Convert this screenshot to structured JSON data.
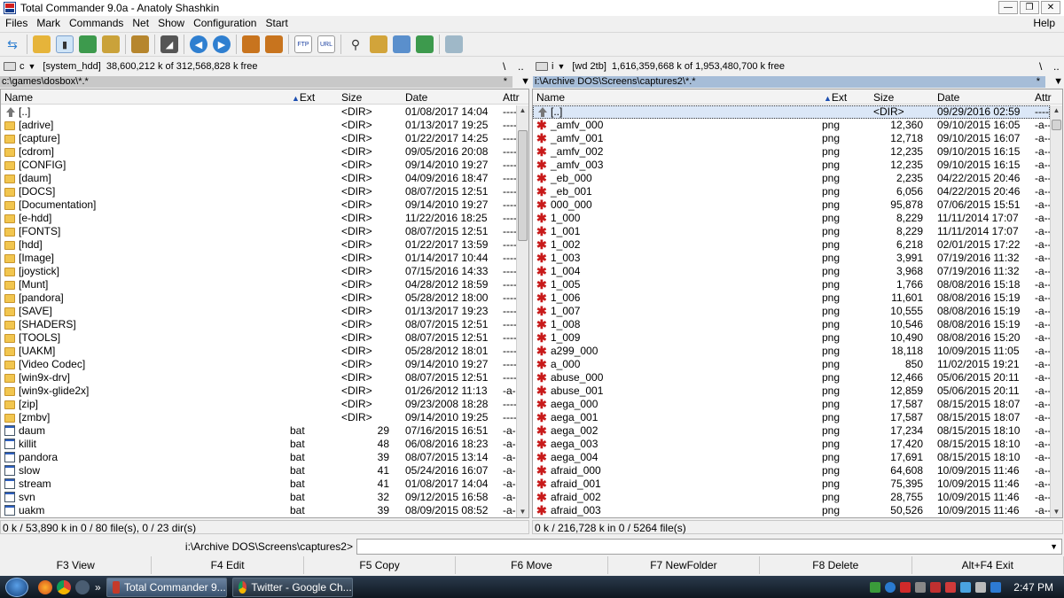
{
  "window": {
    "title": "Total Commander 9.0a - Anatoly Shashkin"
  },
  "menu": {
    "items": [
      "Files",
      "Mark",
      "Commands",
      "Net",
      "Show",
      "Configuration",
      "Start"
    ],
    "help": "Help"
  },
  "toolbar": {
    "icons": [
      "refresh-icon",
      "brief-view-icon",
      "tree-view-icon",
      "thumbnails-icon",
      "sync-icon",
      "invert-icon",
      "compare-icon",
      "back-icon",
      "forward-icon",
      "pack-icon",
      "unpack-icon",
      "ftp-icon",
      "url-icon",
      "search-icon",
      "multi-rename-icon",
      "sync-dirs-icon",
      "copy-names-icon",
      "notepad-icon"
    ]
  },
  "left": {
    "drive": "c",
    "drive_label": "[system_hdd]",
    "free": "38,600,212 k of 312,568,828 k free",
    "backslash": "\\",
    "dotdot": "..",
    "path": "c:\\games\\dosbox\\*.*",
    "star": "*",
    "headers": {
      "name": "Name",
      "ext": "Ext",
      "size": "Size",
      "date": "Date",
      "attr": "Attr"
    },
    "rows": [
      {
        "t": "up",
        "name": "[..]",
        "ext": "",
        "size": "<DIR>",
        "date": "01/08/2017 14:04",
        "attr": "----"
      },
      {
        "t": "dir",
        "name": "[adrive]",
        "ext": "",
        "size": "<DIR>",
        "date": "01/13/2017 19:25",
        "attr": "----"
      },
      {
        "t": "dir",
        "name": "[capture]",
        "ext": "",
        "size": "<DIR>",
        "date": "01/22/2017 14:25",
        "attr": "----"
      },
      {
        "t": "dir",
        "name": "[cdrom]",
        "ext": "",
        "size": "<DIR>",
        "date": "09/05/2016 20:08",
        "attr": "----"
      },
      {
        "t": "dir",
        "name": "[CONFIG]",
        "ext": "",
        "size": "<DIR>",
        "date": "09/14/2010 19:27",
        "attr": "----"
      },
      {
        "t": "dir",
        "name": "[daum]",
        "ext": "",
        "size": "<DIR>",
        "date": "04/09/2016 18:47",
        "attr": "----"
      },
      {
        "t": "dir",
        "name": "[DOCS]",
        "ext": "",
        "size": "<DIR>",
        "date": "08/07/2015 12:51",
        "attr": "----"
      },
      {
        "t": "dir",
        "name": "[Documentation]",
        "ext": "",
        "size": "<DIR>",
        "date": "09/14/2010 19:27",
        "attr": "----"
      },
      {
        "t": "dir",
        "name": "[e-hdd]",
        "ext": "",
        "size": "<DIR>",
        "date": "11/22/2016 18:25",
        "attr": "----"
      },
      {
        "t": "dir",
        "name": "[FONTS]",
        "ext": "",
        "size": "<DIR>",
        "date": "08/07/2015 12:51",
        "attr": "----"
      },
      {
        "t": "dir",
        "name": "[hdd]",
        "ext": "",
        "size": "<DIR>",
        "date": "01/22/2017 13:59",
        "attr": "----"
      },
      {
        "t": "dir",
        "name": "[Image]",
        "ext": "",
        "size": "<DIR>",
        "date": "01/14/2017 10:44",
        "attr": "----"
      },
      {
        "t": "dir",
        "name": "[joystick]",
        "ext": "",
        "size": "<DIR>",
        "date": "07/15/2016 14:33",
        "attr": "----"
      },
      {
        "t": "dir",
        "name": "[Munt]",
        "ext": "",
        "size": "<DIR>",
        "date": "04/28/2012 18:59",
        "attr": "----"
      },
      {
        "t": "dir",
        "name": "[pandora]",
        "ext": "",
        "size": "<DIR>",
        "date": "05/28/2012 18:00",
        "attr": "----"
      },
      {
        "t": "dir",
        "name": "[SAVE]",
        "ext": "",
        "size": "<DIR>",
        "date": "01/13/2017 19:23",
        "attr": "----"
      },
      {
        "t": "dir",
        "name": "[SHADERS]",
        "ext": "",
        "size": "<DIR>",
        "date": "08/07/2015 12:51",
        "attr": "----"
      },
      {
        "t": "dir",
        "name": "[TOOLS]",
        "ext": "",
        "size": "<DIR>",
        "date": "08/07/2015 12:51",
        "attr": "----"
      },
      {
        "t": "dir",
        "name": "[UAKM]",
        "ext": "",
        "size": "<DIR>",
        "date": "05/28/2012 18:01",
        "attr": "----"
      },
      {
        "t": "dir",
        "name": "[Video Codec]",
        "ext": "",
        "size": "<DIR>",
        "date": "09/14/2010 19:27",
        "attr": "----"
      },
      {
        "t": "dir",
        "name": "[win9x-drv]",
        "ext": "",
        "size": "<DIR>",
        "date": "08/07/2015 12:51",
        "attr": "----"
      },
      {
        "t": "dir",
        "name": "[win9x-glide2x]",
        "ext": "",
        "size": "<DIR>",
        "date": "01/26/2012 11:13",
        "attr": "-a--"
      },
      {
        "t": "dir",
        "name": "[zip]",
        "ext": "",
        "size": "<DIR>",
        "date": "09/23/2008 18:28",
        "attr": "----"
      },
      {
        "t": "dir",
        "name": "[zmbv]",
        "ext": "",
        "size": "<DIR>",
        "date": "09/14/2010 19:25",
        "attr": "----"
      },
      {
        "t": "file",
        "name": "daum",
        "ext": "bat",
        "size": "29",
        "date": "07/16/2015 16:51",
        "attr": "-a--"
      },
      {
        "t": "file",
        "name": "killit",
        "ext": "bat",
        "size": "48",
        "date": "06/08/2016 18:23",
        "attr": "-a--"
      },
      {
        "t": "file",
        "name": "pandora",
        "ext": "bat",
        "size": "39",
        "date": "08/07/2015 13:14",
        "attr": "-a--"
      },
      {
        "t": "file",
        "name": "slow",
        "ext": "bat",
        "size": "41",
        "date": "05/24/2016 16:07",
        "attr": "-a--"
      },
      {
        "t": "file",
        "name": "stream",
        "ext": "bat",
        "size": "41",
        "date": "01/08/2017 14:04",
        "attr": "-a--"
      },
      {
        "t": "file",
        "name": "svn",
        "ext": "bat",
        "size": "32",
        "date": "09/12/2015 16:58",
        "attr": "-a--"
      },
      {
        "t": "file",
        "name": "uakm",
        "ext": "bat",
        "size": "39",
        "date": "08/09/2015 08:52",
        "attr": "-a--"
      }
    ],
    "status": "0 k / 53,890 k in 0 / 80 file(s), 0 / 23 dir(s)",
    "scroll": 0.05
  },
  "right": {
    "drive": "i",
    "drive_label": "[wd 2tb]",
    "free": "1,616,359,668 k of 1,953,480,700 k free",
    "backslash": "\\",
    "dotdot": "..",
    "path": "i:\\Archive DOS\\Screens\\captures2\\*.*",
    "star": "*",
    "headers": {
      "name": "Name",
      "ext": "Ext",
      "size": "Size",
      "date": "Date",
      "attr": "Attr"
    },
    "rows": [
      {
        "t": "up",
        "name": "[..]",
        "ext": "",
        "size": "<DIR>",
        "date": "09/29/2016 02:59",
        "attr": "----"
      },
      {
        "t": "png",
        "name": "_amfv_000",
        "ext": "png",
        "size": "12,360",
        "date": "09/10/2015 16:05",
        "attr": "-a--"
      },
      {
        "t": "png",
        "name": "_amfv_001",
        "ext": "png",
        "size": "12,718",
        "date": "09/10/2015 16:07",
        "attr": "-a--"
      },
      {
        "t": "png",
        "name": "_amfv_002",
        "ext": "png",
        "size": "12,235",
        "date": "09/10/2015 16:15",
        "attr": "-a--"
      },
      {
        "t": "png",
        "name": "_amfv_003",
        "ext": "png",
        "size": "12,235",
        "date": "09/10/2015 16:15",
        "attr": "-a--"
      },
      {
        "t": "png",
        "name": "_eb_000",
        "ext": "png",
        "size": "2,235",
        "date": "04/22/2015 20:46",
        "attr": "-a--"
      },
      {
        "t": "png",
        "name": "_eb_001",
        "ext": "png",
        "size": "6,056",
        "date": "04/22/2015 20:46",
        "attr": "-a--"
      },
      {
        "t": "png",
        "name": "000_000",
        "ext": "png",
        "size": "95,878",
        "date": "07/06/2015 15:51",
        "attr": "-a--"
      },
      {
        "t": "png",
        "name": "1_000",
        "ext": "png",
        "size": "8,229",
        "date": "11/11/2014 17:07",
        "attr": "-a--"
      },
      {
        "t": "png",
        "name": "1_001",
        "ext": "png",
        "size": "8,229",
        "date": "11/11/2014 17:07",
        "attr": "-a--"
      },
      {
        "t": "png",
        "name": "1_002",
        "ext": "png",
        "size": "6,218",
        "date": "02/01/2015 17:22",
        "attr": "-a--"
      },
      {
        "t": "png",
        "name": "1_003",
        "ext": "png",
        "size": "3,991",
        "date": "07/19/2016 11:32",
        "attr": "-a--"
      },
      {
        "t": "png",
        "name": "1_004",
        "ext": "png",
        "size": "3,968",
        "date": "07/19/2016 11:32",
        "attr": "-a--"
      },
      {
        "t": "png",
        "name": "1_005",
        "ext": "png",
        "size": "1,766",
        "date": "08/08/2016 15:18",
        "attr": "-a--"
      },
      {
        "t": "png",
        "name": "1_006",
        "ext": "png",
        "size": "11,601",
        "date": "08/08/2016 15:19",
        "attr": "-a--"
      },
      {
        "t": "png",
        "name": "1_007",
        "ext": "png",
        "size": "10,555",
        "date": "08/08/2016 15:19",
        "attr": "-a--"
      },
      {
        "t": "png",
        "name": "1_008",
        "ext": "png",
        "size": "10,546",
        "date": "08/08/2016 15:19",
        "attr": "-a--"
      },
      {
        "t": "png",
        "name": "1_009",
        "ext": "png",
        "size": "10,490",
        "date": "08/08/2016 15:20",
        "attr": "-a--"
      },
      {
        "t": "png",
        "name": "a299_000",
        "ext": "png",
        "size": "18,118",
        "date": "10/09/2015 11:05",
        "attr": "-a--"
      },
      {
        "t": "png",
        "name": "a_000",
        "ext": "png",
        "size": "850",
        "date": "11/02/2015 19:21",
        "attr": "-a--"
      },
      {
        "t": "png",
        "name": "abuse_000",
        "ext": "png",
        "size": "12,466",
        "date": "05/06/2015 20:11",
        "attr": "-a--"
      },
      {
        "t": "png",
        "name": "abuse_001",
        "ext": "png",
        "size": "12,859",
        "date": "05/06/2015 20:11",
        "attr": "-a--"
      },
      {
        "t": "png",
        "name": "aega_000",
        "ext": "png",
        "size": "17,587",
        "date": "08/15/2015 18:07",
        "attr": "-a--"
      },
      {
        "t": "png",
        "name": "aega_001",
        "ext": "png",
        "size": "17,587",
        "date": "08/15/2015 18:07",
        "attr": "-a--"
      },
      {
        "t": "png",
        "name": "aega_002",
        "ext": "png",
        "size": "17,234",
        "date": "08/15/2015 18:10",
        "attr": "-a--"
      },
      {
        "t": "png",
        "name": "aega_003",
        "ext": "png",
        "size": "17,420",
        "date": "08/15/2015 18:10",
        "attr": "-a--"
      },
      {
        "t": "png",
        "name": "aega_004",
        "ext": "png",
        "size": "17,691",
        "date": "08/15/2015 18:10",
        "attr": "-a--"
      },
      {
        "t": "png",
        "name": "afraid_000",
        "ext": "png",
        "size": "64,608",
        "date": "10/09/2015 11:46",
        "attr": "-a--"
      },
      {
        "t": "png",
        "name": "afraid_001",
        "ext": "png",
        "size": "75,395",
        "date": "10/09/2015 11:46",
        "attr": "-a--"
      },
      {
        "t": "png",
        "name": "afraid_002",
        "ext": "png",
        "size": "28,755",
        "date": "10/09/2015 11:46",
        "attr": "-a--"
      },
      {
        "t": "png",
        "name": "afraid_003",
        "ext": "png",
        "size": "50,526",
        "date": "10/09/2015 11:46",
        "attr": "-a--"
      }
    ],
    "status": "0 k / 216,728 k in 0 / 5264 file(s)",
    "scroll": 0.01
  },
  "cmdline": {
    "path": "i:\\Archive DOS\\Screens\\captures2>"
  },
  "fkeys": [
    "F3 View",
    "F4 Edit",
    "F5 Copy",
    "F6 Move",
    "F7 NewFolder",
    "F8 Delete",
    "Alt+F4 Exit"
  ],
  "taskbar": {
    "tasks": [
      "Total Commander 9...",
      "Twitter - Google Ch..."
    ],
    "clock": "2:47 PM",
    "more": "»"
  },
  "colors": {
    "path_active": "#a6bdd8",
    "png_icon": "#c81a1a",
    "folder": "#f2c64f"
  }
}
